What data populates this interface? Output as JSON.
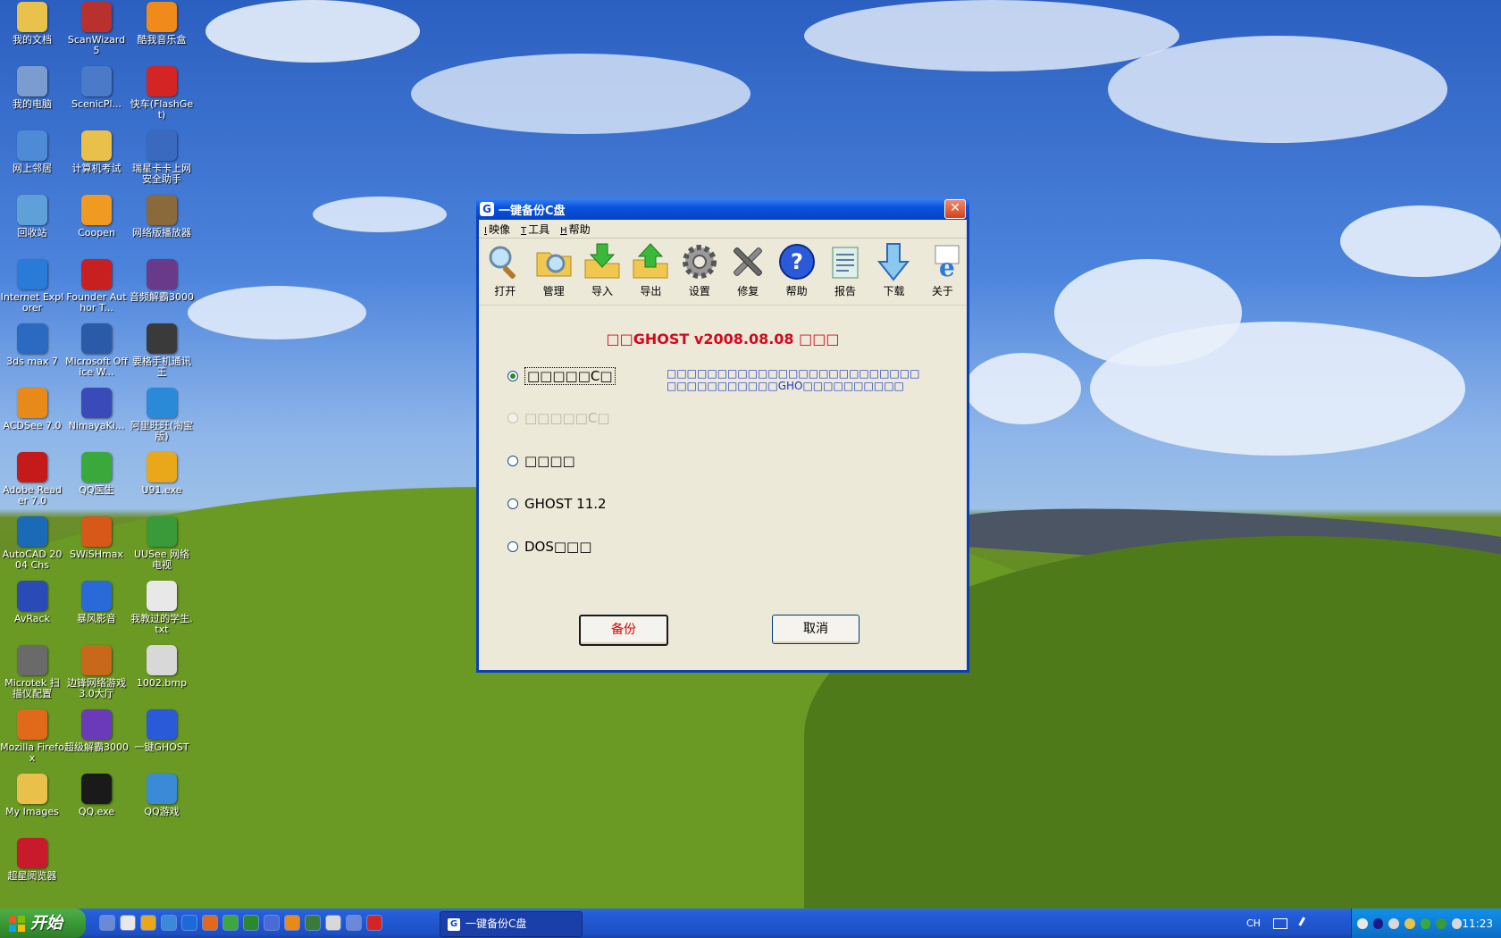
{
  "desktop": {
    "icons": [
      {
        "label": "我的文档",
        "icon": "documents-folder-icon",
        "color": "#e8c24a"
      },
      {
        "label": "ScanWizard 5",
        "icon": "scanwizard-icon",
        "color": "#b8312f"
      },
      {
        "label": "酷我音乐盒",
        "icon": "kuwo-music-icon",
        "color": "#f08a1a"
      },
      {
        "label": "我的电脑",
        "icon": "my-computer-icon",
        "color": "#7a9ccf"
      },
      {
        "label": "ScenicPl...",
        "icon": "scenicplayer-icon",
        "color": "#4a7ac8"
      },
      {
        "label": "快车(FlashGet)",
        "icon": "flashget-icon",
        "color": "#d42424"
      },
      {
        "label": "网上邻居",
        "icon": "network-places-icon",
        "color": "#4f8ad6"
      },
      {
        "label": "计算机考试",
        "icon": "folder-icon",
        "color": "#e9c04a"
      },
      {
        "label": "瑞星卡卡上网安全助手",
        "icon": "rising-kaka-icon",
        "color": "#3a6abf"
      },
      {
        "label": "回收站",
        "icon": "recycle-bin-icon",
        "color": "#5fa0d8"
      },
      {
        "label": "Coopen",
        "icon": "coopen-icon",
        "color": "#f19a22"
      },
      {
        "label": "网络版播放器",
        "icon": "network-player-icon",
        "color": "#8a6a3a"
      },
      {
        "label": "Internet Explorer",
        "icon": "internet-explorer-icon",
        "color": "#2a7ad8"
      },
      {
        "label": "Founder Author T...",
        "icon": "founder-author-icon",
        "color": "#c82020"
      },
      {
        "label": "音频解霸3000",
        "icon": "audio-player-icon",
        "color": "#6a3a8a"
      },
      {
        "label": "3ds max 7",
        "icon": "3dsmax-icon",
        "color": "#2a6ac0"
      },
      {
        "label": "Microsoft Office W...",
        "icon": "ms-word-icon",
        "color": "#2b5aa8"
      },
      {
        "label": "要格手机通讯王",
        "icon": "phone-tool-icon",
        "color": "#3a3a3a"
      },
      {
        "label": "ACDSee 7.0",
        "icon": "acdsee-icon",
        "color": "#e88a1a"
      },
      {
        "label": "NimayaKi...",
        "icon": "nimaya-icon",
        "color": "#3a4ab8"
      },
      {
        "label": "阿里旺旺(淘宝版)",
        "icon": "aliwangwang-icon",
        "color": "#2a8ad8"
      },
      {
        "label": "Adobe Reader 7.0",
        "icon": "adobe-reader-icon",
        "color": "#c41a1a"
      },
      {
        "label": "QQ医生",
        "icon": "qq-doctor-icon",
        "color": "#3aa83a"
      },
      {
        "label": "U91.exe",
        "icon": "u91-icon",
        "color": "#e8a81a"
      },
      {
        "label": "AutoCAD 2004 Chs",
        "icon": "autocad-icon",
        "color": "#1a6ab8"
      },
      {
        "label": "SWiSHmax",
        "icon": "swishmax-icon",
        "color": "#d8581a"
      },
      {
        "label": "UUSee 网络电视",
        "icon": "uusee-icon",
        "color": "#3a9a3a"
      },
      {
        "label": "AvRack",
        "icon": "avrack-icon",
        "color": "#2a4ab8"
      },
      {
        "label": "暴风影音",
        "icon": "storm-player-icon",
        "color": "#2a6ad8"
      },
      {
        "label": "我教过的学生.txt",
        "icon": "text-file-icon",
        "color": "#e8e8e8"
      },
      {
        "label": "Microtek 扫描仪配置",
        "icon": "scanner-config-icon",
        "color": "#6a6a6a"
      },
      {
        "label": "边锋网络游戏3.0大厅",
        "icon": "bianfeng-game-icon",
        "color": "#c8681a"
      },
      {
        "label": "1002.bmp",
        "icon": "bitmap-file-icon",
        "color": "#d8d8d8"
      },
      {
        "label": "Mozilla Firefox",
        "icon": "firefox-icon",
        "color": "#e06a1a"
      },
      {
        "label": "超级解霸3000",
        "icon": "super-player-icon",
        "color": "#6a3ab8"
      },
      {
        "label": "一键GHOST",
        "icon": "onekey-ghost-icon",
        "color": "#2a5ad8"
      },
      {
        "label": "My Images",
        "icon": "images-folder-icon",
        "color": "#e9c04a"
      },
      {
        "label": "QQ.exe",
        "icon": "qq-icon",
        "color": "#1a1a1a"
      },
      {
        "label": "QQ游戏",
        "icon": "qq-game-icon",
        "color": "#3a8ad8"
      },
      {
        "label": "超星阅览器",
        "icon": "superstar-reader-icon",
        "color": "#c81a2a"
      }
    ]
  },
  "dialog": {
    "title": "一键备份C盘",
    "app_icon": "G",
    "close_glyph": "✕",
    "menu": [
      {
        "key": "I",
        "label": "映像"
      },
      {
        "key": "T",
        "label": "工具"
      },
      {
        "key": "H",
        "label": "帮助"
      }
    ],
    "toolbar": [
      {
        "label": "打开",
        "icon": "open-magnifier-icon"
      },
      {
        "label": "管理",
        "icon": "manage-folder-icon"
      },
      {
        "label": "导入",
        "icon": "import-folder-icon"
      },
      {
        "label": "导出",
        "icon": "export-folder-icon"
      },
      {
        "label": "设置",
        "icon": "settings-gear-icon"
      },
      {
        "label": "修复",
        "icon": "repair-tools-icon"
      },
      {
        "label": "帮助",
        "icon": "help-question-icon"
      },
      {
        "label": "报告",
        "icon": "report-notepad-icon"
      },
      {
        "label": "下载",
        "icon": "download-arrow-icon"
      },
      {
        "label": "关于",
        "icon": "about-ie-icon"
      }
    ],
    "heading": "□□GHOST v2008.08.08 □□□",
    "options": [
      {
        "label": "□□□□□C□",
        "checked": true,
        "disabled": false
      },
      {
        "label": "□□□□□C□",
        "checked": false,
        "disabled": true
      },
      {
        "label": "□□□□",
        "checked": false,
        "disabled": false
      },
      {
        "label": "GHOST 11.2",
        "checked": false,
        "disabled": false
      },
      {
        "label": "DOS□□□",
        "checked": false,
        "disabled": false
      }
    ],
    "description_line1": "□□□□□□□□□□□□□□□□□□□□□□□□□",
    "description_line2": "□□□□□□□□□□□GHO□□□□□□□□□□",
    "ok_button": "备份",
    "cancel_button": "取消"
  },
  "taskbar": {
    "start_label": "开始",
    "quick_launch": [
      {
        "icon": "show-desktop-icon",
        "color": "#6a8ad8"
      },
      {
        "icon": "media-player-icon",
        "color": "#e8e8e8"
      },
      {
        "icon": "qq-tray-icon",
        "color": "#e8a81a"
      },
      {
        "icon": "browser-icon",
        "color": "#3a8ad8"
      },
      {
        "icon": "ie-quick-icon",
        "color": "#1a6ad8"
      },
      {
        "icon": "firefox-quick-icon",
        "color": "#e06a1a"
      },
      {
        "icon": "qq-doctor-quick-icon",
        "color": "#3aa83a"
      },
      {
        "icon": "antivirus-icon",
        "color": "#2a8a2a"
      },
      {
        "icon": "network-quick-icon",
        "color": "#4a6ad8"
      },
      {
        "icon": "flashget-quick-icon",
        "color": "#e88a1a"
      },
      {
        "icon": "chart-quick-icon",
        "color": "#3a7a3a"
      },
      {
        "icon": "tool-quick-icon",
        "color": "#d8d8d8"
      },
      {
        "icon": "player-quick-icon",
        "color": "#6a8ad8"
      },
      {
        "icon": "kuaiche-quick-icon",
        "color": "#d42424"
      }
    ],
    "active_task": "一键备份C盘",
    "language": "CH",
    "tray_icons": [
      {
        "icon": "tray-qq-icon",
        "color": "#e8e8e8"
      },
      {
        "icon": "tray-network-icon",
        "color": "#1a1a8a"
      },
      {
        "icon": "tray-volume-icon",
        "color": "#d8d8d8"
      },
      {
        "icon": "tray-av-icon",
        "color": "#e8c24a"
      },
      {
        "icon": "tray-update-icon",
        "color": "#3aa83a"
      },
      {
        "icon": "tray-umbrella-icon",
        "color": "#3a9a3a"
      },
      {
        "icon": "tray-monitor-icon",
        "color": "#d8d8d8"
      }
    ],
    "clock": "11:23"
  }
}
